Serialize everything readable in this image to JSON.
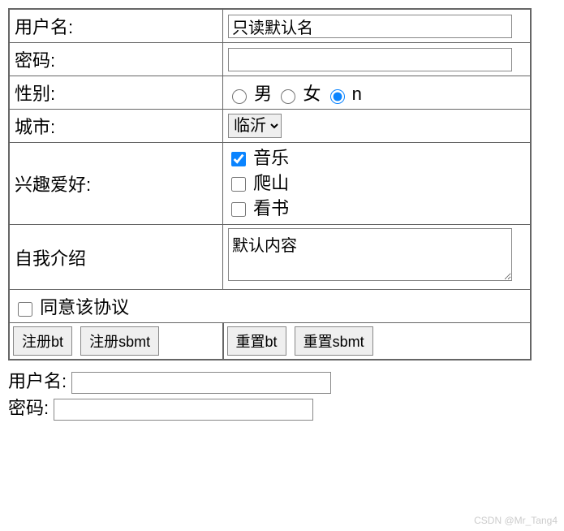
{
  "form": {
    "username_label": "用户名:",
    "username_value": "只读默认名",
    "password_label": "密码:",
    "gender_label": "性别:",
    "gender_options": {
      "male": "男",
      "female": "女",
      "n": "n"
    },
    "city_label": "城市:",
    "city_selected": "临沂",
    "hobby_label": "兴趣爱好:",
    "hobbies": {
      "music": "音乐",
      "climb": "爬山",
      "read": "看书"
    },
    "intro_label": "自我介绍",
    "intro_value": "默认内容",
    "agree_label": "同意该协议",
    "buttons": {
      "register_bt": "注册bt",
      "register_sbmt": "注册sbmt",
      "reset_bt": "重置bt",
      "reset_sbmt": "重置sbmt"
    }
  },
  "below": {
    "username_label": "用户名:",
    "password_label": "密码:"
  },
  "watermark": "CSDN @Mr_Tang4"
}
